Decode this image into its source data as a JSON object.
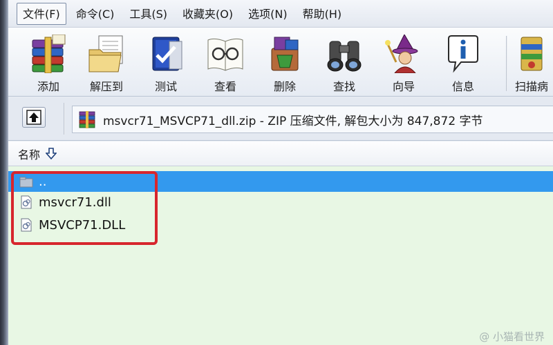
{
  "menubar": {
    "items": [
      {
        "label": "文件(F)",
        "active": true
      },
      {
        "label": "命令(C)"
      },
      {
        "label": "工具(S)"
      },
      {
        "label": "收藏夹(O)"
      },
      {
        "label": "选项(N)"
      },
      {
        "label": "帮助(H)"
      }
    ]
  },
  "toolbar": {
    "buttons": [
      {
        "label": "添加",
        "icon": "books-add-icon"
      },
      {
        "label": "解压到",
        "icon": "folder-extract-icon"
      },
      {
        "label": "测试",
        "icon": "test-checkmark-icon"
      },
      {
        "label": "查看",
        "icon": "view-glasses-icon"
      },
      {
        "label": "删除",
        "icon": "delete-icon"
      },
      {
        "label": "查找",
        "icon": "binoculars-icon"
      },
      {
        "label": "向导",
        "icon": "wizard-icon"
      },
      {
        "label": "信息",
        "icon": "info-icon"
      },
      {
        "label": "扫描病",
        "icon": "virus-scan-icon"
      }
    ]
  },
  "addressbar": {
    "path": "msvcr71_MSVCP71_dll.zip - ZIP 压缩文件, 解包大小为 847,872 字节",
    "up_icon": "up-folder-icon"
  },
  "list": {
    "column_name": "名称",
    "sort_icon": "sort-down-arrow-icon",
    "rows": [
      {
        "name": "..",
        "selected": true
      },
      {
        "name": "msvcr71.dll"
      },
      {
        "name": "MSVCP71.DLL"
      }
    ]
  },
  "colors": {
    "selection": "#3399ee",
    "list_background": "#e8f7e4",
    "highlight": "#d7262d"
  },
  "watermark": "@ 小猫看世界"
}
